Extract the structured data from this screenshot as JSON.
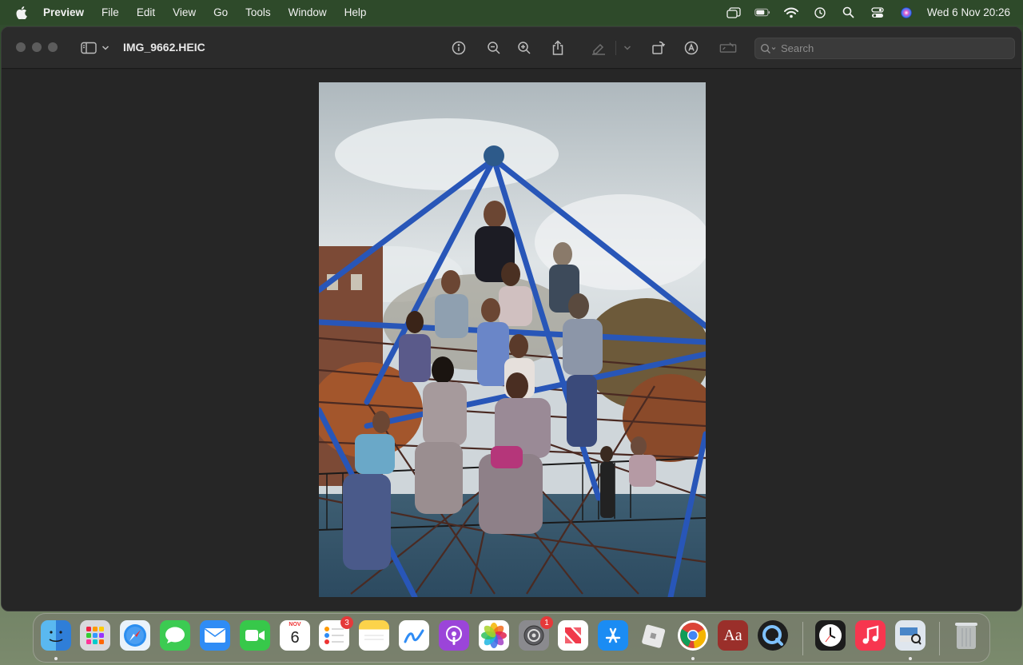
{
  "menubar": {
    "app_name": "Preview",
    "items": [
      "File",
      "Edit",
      "View",
      "Go",
      "Tools",
      "Window",
      "Help"
    ],
    "clock": "Wed 6 Nov  20:26"
  },
  "window": {
    "document_title": "IMG_9662.HEIC",
    "search_placeholder": "Search"
  },
  "dock": {
    "calendar_month": "NOV",
    "calendar_day": "6",
    "reminders_badge": "3",
    "settings_badge": "1",
    "dictionary_label": "Aa",
    "apps": [
      "finder-icon",
      "launchpad-icon",
      "safari-icon",
      "messages-icon",
      "mail-icon",
      "facetime-icon",
      "calendar-icon",
      "reminders-icon",
      "notes-icon",
      "freeform-icon",
      "podcasts-icon",
      "photos-icon",
      "system-settings-icon",
      "news-icon",
      "app-store-icon",
      "roblox-icon",
      "chrome-icon",
      "dictionary-icon",
      "quicktime-icon",
      "clock-icon",
      "music-icon",
      "preview-icon",
      "trash-icon"
    ]
  },
  "colors": {
    "menubar_bg": "#2e4a2a",
    "window_bg": "#232323",
    "accent_blue": "#2856b8"
  }
}
